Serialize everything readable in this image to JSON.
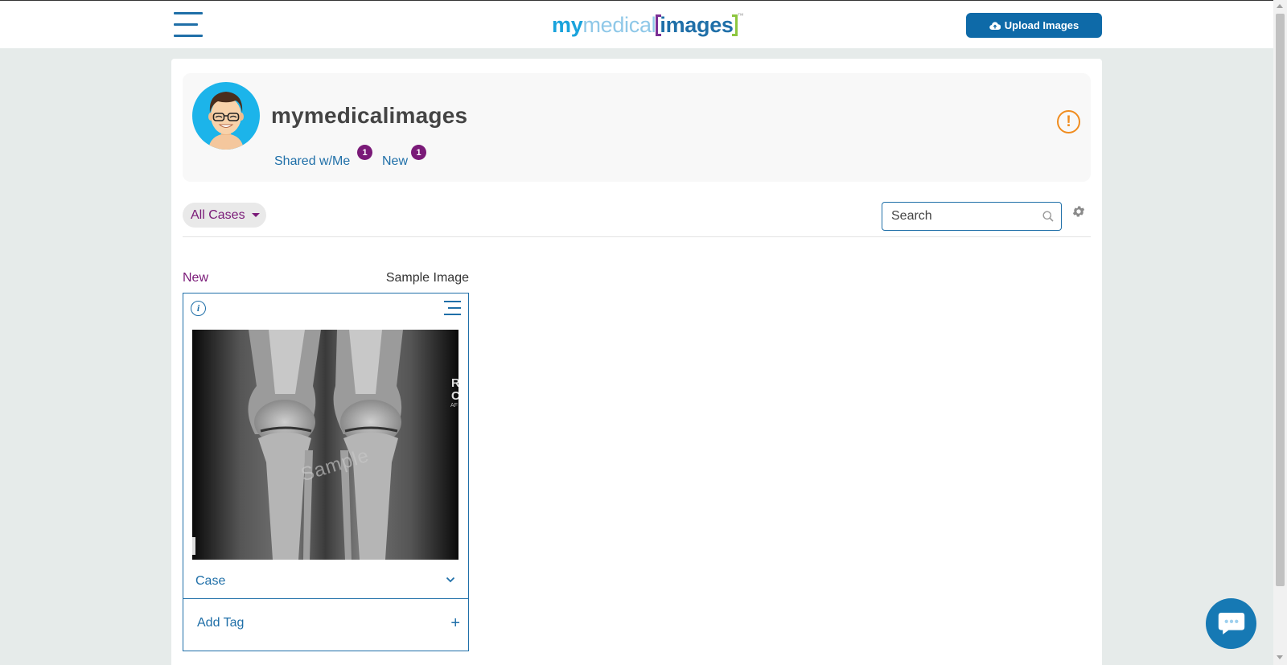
{
  "header": {
    "logo": {
      "my": "my",
      "medical": "medical",
      "images": "images",
      "tm": "™"
    },
    "upload_label": "Upload Images"
  },
  "profile": {
    "name": "mymedicalimages",
    "links": [
      {
        "label": "Shared w/Me",
        "badge": "1"
      },
      {
        "label": "New",
        "badge": "1"
      }
    ],
    "alert_glyph": "!"
  },
  "toolbar": {
    "filter_label": "All Cases",
    "search_placeholder": "Search"
  },
  "cases": [
    {
      "status": "New",
      "title": "Sample Image",
      "watermark": "Sample",
      "image_markings": [
        "R",
        "C",
        "AF"
      ],
      "case_label": "Case",
      "tag_label": "Add Tag",
      "info_glyph": "i",
      "add_glyph": "+"
    }
  ],
  "icons": {
    "menu": "hamburger-menu-icon",
    "upload": "cloud-upload-icon",
    "alert": "exclamation-circle-icon",
    "search": "search-icon",
    "settings": "gear-icon",
    "info": "info-icon",
    "card_menu": "list-menu-icon",
    "expand": "chevron-down-icon",
    "add": "plus-icon",
    "chat": "chat-bubble-icon"
  },
  "colors": {
    "primary": "#1f6fa8",
    "upload_button": "#0e6aa8",
    "accent_purple": "#7a1a78",
    "alert_orange": "#f08c1e",
    "avatar_bg": "#1cb4ea",
    "page_bg": "#e6ebea"
  }
}
